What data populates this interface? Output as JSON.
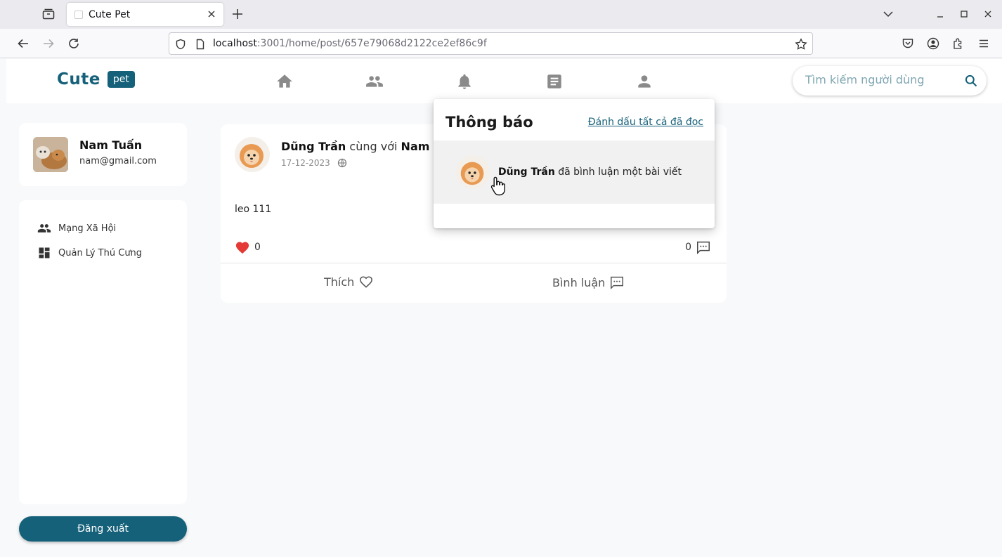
{
  "browser": {
    "tab_title": "Cute Pet",
    "url_host": "localhost",
    "url_rest": ":3001/home/post/657e79068d2122ce2ef86c9f"
  },
  "header": {
    "logo_text": "Cute",
    "logo_badge": "pet",
    "search_placeholder": "Tìm kiếm người dùng",
    "nav_icons": [
      "home-icon",
      "friends-icon",
      "bell-icon",
      "article-icon",
      "person-icon"
    ],
    "brand_color": "#16617a"
  },
  "profile": {
    "name": "Nam Tuấn",
    "email": "nam@gmail.com"
  },
  "sidebar": {
    "items": [
      {
        "label": "Mạng Xã Hội",
        "icon": "people-icon"
      },
      {
        "label": "Quản Lý Thú Cưng",
        "icon": "dashboard-icon"
      }
    ],
    "logout_label": "Đăng xuất"
  },
  "post": {
    "author": "Dũng Trần",
    "with_text": "cùng với",
    "tagged": "Nam Tuấn",
    "date": "17-12-2023",
    "content": "leo 111",
    "like_count": "0",
    "comment_count": "0",
    "like_label": "Thích",
    "comment_label": "Bình luận"
  },
  "notifications": {
    "title": "Thông báo",
    "mark_all": "Đánh dấu tất cả đã đọc",
    "items": [
      {
        "actor": "Dũng Trần",
        "text": "đã bình luận một bài viết"
      }
    ]
  }
}
